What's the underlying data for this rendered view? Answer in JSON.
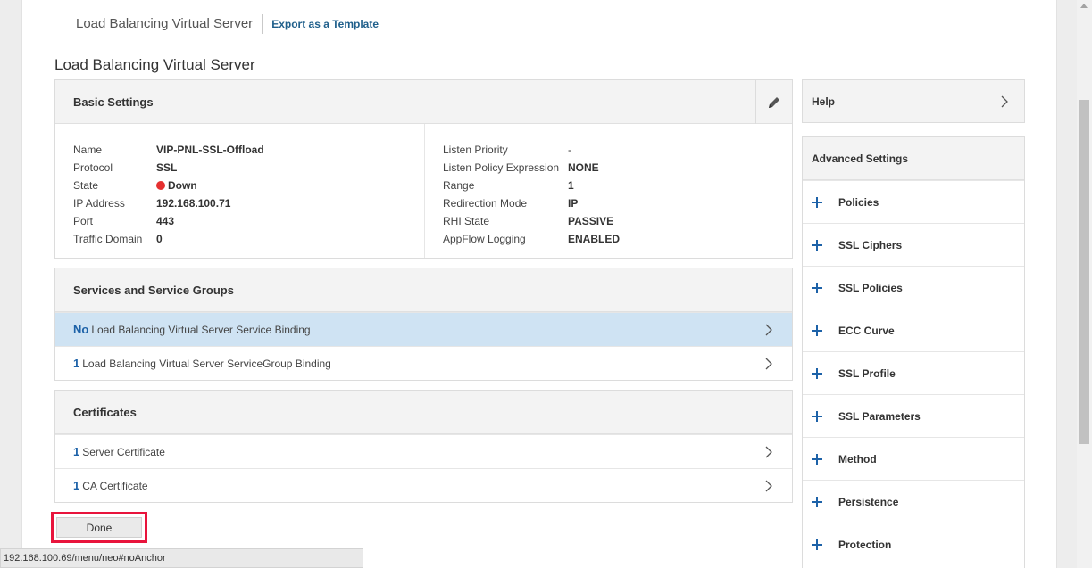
{
  "breadcrumb": {
    "current": "Load Balancing Virtual Server",
    "export_link": "Export as a Template"
  },
  "page_title": "Load Balancing Virtual Server",
  "basic_settings": {
    "title": "Basic Settings",
    "left": [
      {
        "label": "Name",
        "value": "VIP-PNL-SSL-Offload"
      },
      {
        "label": "Protocol",
        "value": "SSL"
      },
      {
        "label": "State",
        "value": "Down"
      },
      {
        "label": "IP Address",
        "value": "192.168.100.71"
      },
      {
        "label": "Port",
        "value": "443"
      },
      {
        "label": "Traffic Domain",
        "value": "0"
      }
    ],
    "right": [
      {
        "label": "Listen Priority",
        "value": "-"
      },
      {
        "label": "Listen Policy Expression",
        "value": "NONE"
      },
      {
        "label": "Range",
        "value": "1"
      },
      {
        "label": "Redirection Mode",
        "value": "IP"
      },
      {
        "label": "RHI State",
        "value": "PASSIVE"
      },
      {
        "label": "AppFlow Logging",
        "value": "ENABLED"
      }
    ]
  },
  "services": {
    "title": "Services and Service Groups",
    "rows": [
      {
        "count": "No",
        "label": "Load Balancing Virtual Server Service Binding"
      },
      {
        "count": "1",
        "label": "Load Balancing Virtual Server ServiceGroup Binding"
      }
    ]
  },
  "certificates": {
    "title": "Certificates",
    "rows": [
      {
        "count": "1",
        "label": "Server Certificate"
      },
      {
        "count": "1",
        "label": "CA Certificate"
      }
    ]
  },
  "done_label": "Done",
  "help_label": "Help",
  "advanced": {
    "title": "Advanced Settings",
    "items": [
      "Policies",
      "SSL Ciphers",
      "SSL Policies",
      "ECC Curve",
      "SSL Profile",
      "SSL Parameters",
      "Method",
      "Persistence",
      "Protection"
    ]
  },
  "status_url": "192.168.100.69/menu/neo#noAnchor",
  "colors": {
    "accent": "#1d62a8",
    "selected_row": "#cfe3f3",
    "highlight_border": "#e8143c",
    "state_down": "#e53030"
  }
}
